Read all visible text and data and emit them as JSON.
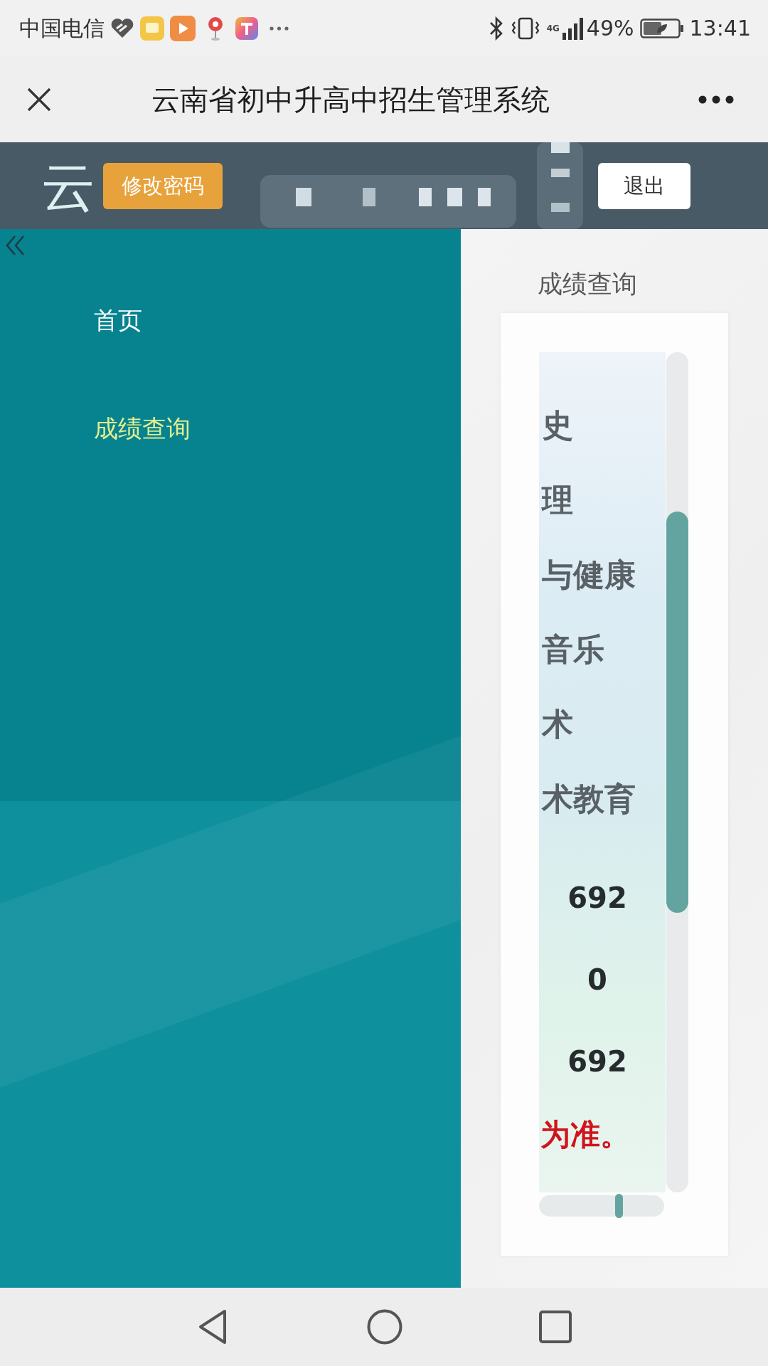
{
  "status_bar": {
    "carrier": "中国电信",
    "network": "4G",
    "battery": "49%",
    "time": "13:41"
  },
  "title_bar": {
    "title": "云南省初中升高中招生管理系统"
  },
  "header": {
    "title": "云",
    "buttons": [
      {
        "label": "修改密码",
        "kind": "primary"
      },
      {
        "label": "退出",
        "kind": "plain"
      }
    ]
  },
  "sidebar": {
    "items": [
      {
        "label": "首页",
        "selected": false
      },
      {
        "label": "成绩查询",
        "selected": true
      }
    ]
  },
  "content": {
    "breadcrumb": "成绩查询",
    "rows": [
      {
        "kind": "subject",
        "text": "史"
      },
      {
        "kind": "subject",
        "text": "理"
      },
      {
        "kind": "subject",
        "text": "与健康"
      },
      {
        "kind": "subject",
        "text": "音乐"
      },
      {
        "kind": "subject",
        "text": "术"
      },
      {
        "kind": "subject",
        "text": "术教育"
      },
      {
        "kind": "number",
        "text": "692"
      },
      {
        "kind": "number",
        "text": "0"
      },
      {
        "kind": "number",
        "text": "692"
      }
    ],
    "note": "为准。"
  }
}
